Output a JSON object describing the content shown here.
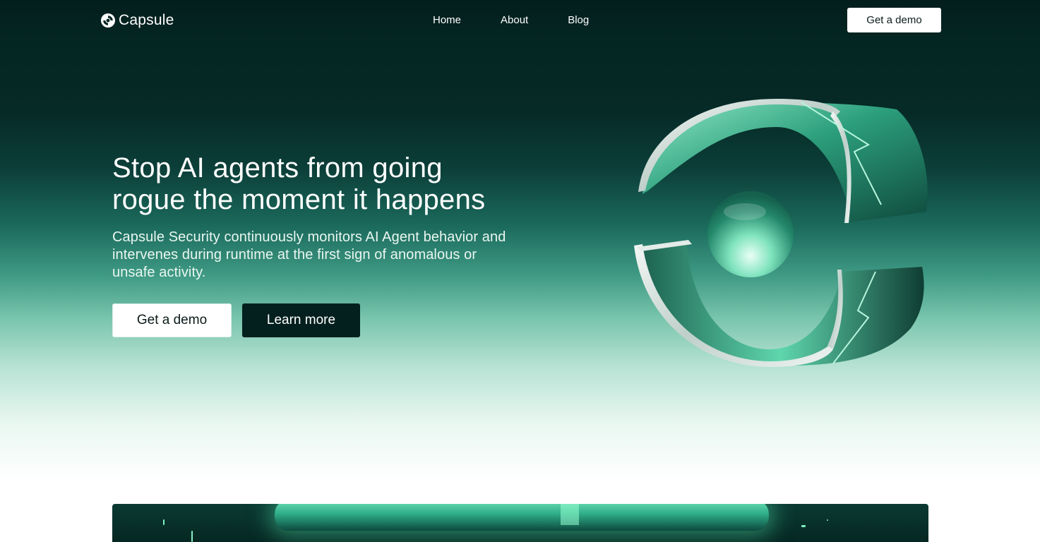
{
  "brand": {
    "name": "Capsule",
    "accent": "#2fae88",
    "dark": "#03201e"
  },
  "nav": {
    "links": [
      "Home",
      "About",
      "Blog"
    ],
    "cta": "Get a demo"
  },
  "hero": {
    "headline_line1": "Stop AI agents from going",
    "headline_line2": "rogue the moment it happens",
    "subtext": "Capsule Security continuously monitors AI Agent behavior and intervenes during runtime at the first sign of anomalous or unsafe activity.",
    "primary_button": "Get a demo",
    "secondary_button": "Learn more"
  },
  "icons": {
    "logo": "capsule-logo-icon",
    "hero_art": "capsule-3d-logo-icon"
  }
}
